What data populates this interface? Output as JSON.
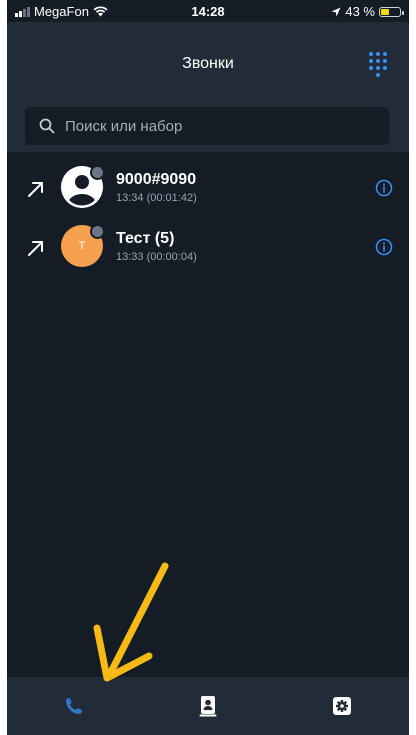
{
  "status_bar": {
    "carrier": "MegaFon",
    "time": "14:28",
    "battery_text": "43 %",
    "battery_level": 0.43
  },
  "header": {
    "title": "Звонки",
    "dialpad_icon": "dialpad-icon"
  },
  "search": {
    "placeholder": "Поиск или набор",
    "icon": "search-icon"
  },
  "calls": [
    {
      "name": "9000#9090",
      "meta": "13:34 (00:01:42)",
      "direction": "outgoing",
      "avatar_type": "contact-icon"
    },
    {
      "name": "Тест (5)",
      "meta": "13:33 (00:00:04)",
      "direction": "outgoing",
      "avatar_type": "letter",
      "avatar_letter": "Т"
    }
  ],
  "tabs": [
    {
      "icon": "phone-icon",
      "active": true
    },
    {
      "icon": "contacts-icon",
      "active": false
    },
    {
      "icon": "settings-icon",
      "active": false
    }
  ],
  "colors": {
    "background": "#141c26",
    "header": "#222c38",
    "accent": "#3a8ff5",
    "annotation_arrow": "#f6b915",
    "tab_highlight": "#6b5a1c",
    "avatar_orange": "#f5a04f"
  }
}
